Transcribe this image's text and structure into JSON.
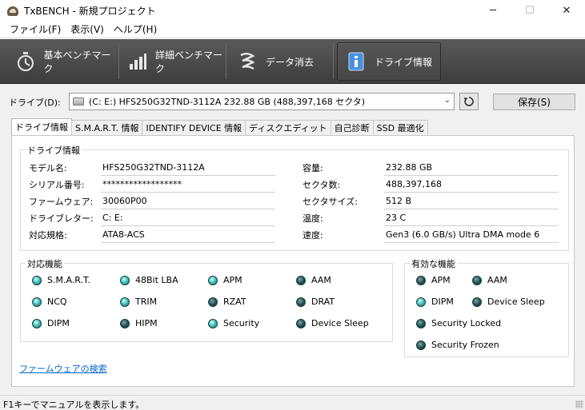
{
  "window": {
    "title": "TxBENCH - 新規プロジェクト",
    "minimize": "─",
    "maximize": "☐",
    "close": "✕"
  },
  "menu": [
    "ファイル(F)",
    "表示(V)",
    "ヘルプ(H)"
  ],
  "toolbar": {
    "items": [
      {
        "label": "基本ベンチマーク",
        "icon": "stopwatch-icon"
      },
      {
        "label": "詳細ベンチマーク",
        "icon": "bar-chart-icon"
      },
      {
        "label": "データ消去",
        "icon": "erase-icon"
      },
      {
        "label": "ドライブ情報",
        "icon": "drive-info-icon",
        "active": true
      }
    ]
  },
  "drive": {
    "label": "ドライブ(D):",
    "selected": "(C: E:) HFS250G32TND-3112A  232.88 GB (488,397,168 セクタ)",
    "save_label": "保存(S)"
  },
  "tabs": [
    "ドライブ情報",
    "S.M.A.R.T. 情報",
    "IDENTIFY DEVICE 情報",
    "ディスクエディット",
    "自己診断",
    "SSD 最適化"
  ],
  "info": {
    "group_title": "ドライブ情報",
    "left": [
      {
        "label": "モデル名:",
        "value": "HFS250G32TND-3112A"
      },
      {
        "label": "シリアル番号:",
        "value": "******************"
      },
      {
        "label": "ファームウェア:",
        "value": "30060P00"
      },
      {
        "label": "ドライブレター:",
        "value": "C: E:"
      },
      {
        "label": "対応規格:",
        "value": "ATA8-ACS"
      }
    ],
    "right": [
      {
        "label": "容量:",
        "value": "232.88 GB"
      },
      {
        "label": "セクタ数:",
        "value": "488,397,168"
      },
      {
        "label": "セクタサイズ:",
        "value": "512 B"
      },
      {
        "label": "温度:",
        "value": "23 C"
      },
      {
        "label": "速度:",
        "value": "Gen3 (6.0 GB/s)  Ultra DMA mode 6"
      }
    ]
  },
  "supported": {
    "title": "対応機能",
    "features": [
      {
        "name": "S.M.A.R.T.",
        "on": true
      },
      {
        "name": "48Bit LBA",
        "on": true
      },
      {
        "name": "APM",
        "on": true
      },
      {
        "name": "AAM",
        "on": false
      },
      {
        "name": "NCQ",
        "on": true
      },
      {
        "name": "TRIM",
        "on": true
      },
      {
        "name": "RZAT",
        "on": false
      },
      {
        "name": "DRAT",
        "on": false
      },
      {
        "name": "DIPM",
        "on": true
      },
      {
        "name": "HIPM",
        "on": false
      },
      {
        "name": "Security",
        "on": true
      },
      {
        "name": "Device Sleep",
        "on": false
      }
    ]
  },
  "enabled": {
    "title": "有効な機能",
    "features": [
      {
        "name": "APM",
        "on": false
      },
      {
        "name": "AAM",
        "on": false
      },
      {
        "name": "DIPM",
        "on": true
      },
      {
        "name": "Device Sleep",
        "on": false
      },
      {
        "name": "Security Locked",
        "on": false
      },
      {
        "name": "Security Frozen",
        "on": false
      }
    ]
  },
  "firmware_link": "ファームウェアの検索",
  "status": "F1キーでマニュアルを表示します。"
}
